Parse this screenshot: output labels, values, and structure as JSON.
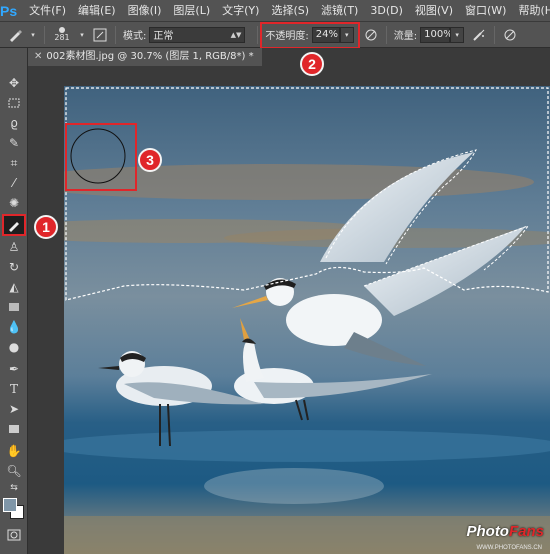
{
  "app": {
    "logo": "Ps"
  },
  "menu": [
    "文件(F)",
    "编辑(E)",
    "图像(I)",
    "图层(L)",
    "文字(Y)",
    "选择(S)",
    "滤镜(T)",
    "3D(D)",
    "视图(V)",
    "窗口(W)",
    "帮助(H)"
  ],
  "options": {
    "brush_size": "281",
    "mode_label": "模式:",
    "mode_value": "正常",
    "opacity_label": "不透明度:",
    "opacity_value": "24%",
    "flow_label": "流量:",
    "flow_value": "100%"
  },
  "tab": {
    "title": "002素材图.jpg @ 30.7% (图层 1, RGB/8*) *"
  },
  "callouts": [
    "1",
    "2",
    "3"
  ],
  "colors": {
    "accent_red": "#e0262a",
    "ui_panel": "#535353",
    "foreground": "#7f96a8",
    "background": "#ffffff"
  },
  "watermark": {
    "brand_a": "Photo",
    "brand_b": "Fans",
    "url": "WWW.PHOTOFANS.CN"
  }
}
